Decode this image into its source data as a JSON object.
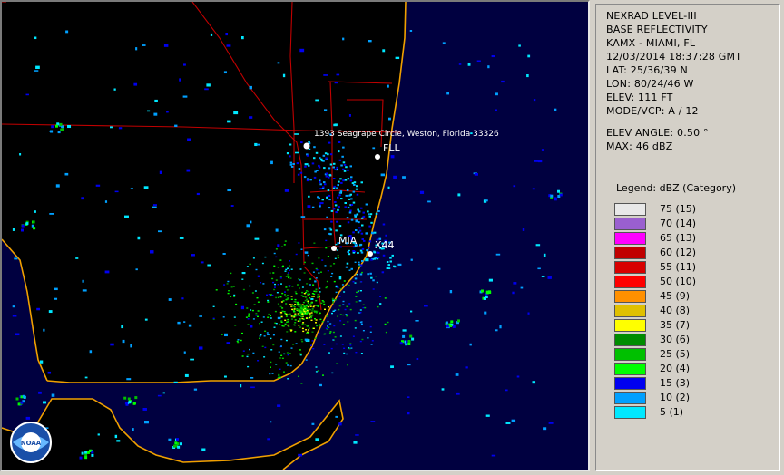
{
  "product": {
    "line1": "NEXRAD LEVEL-III",
    "line2": "BASE REFLECTIVITY",
    "station": "KAMX - MIAMI, FL",
    "datetime": "12/03/2014 18:37:28 GMT",
    "lat": "LAT: 25/36/39 N",
    "lon": "LON: 80/24/46 W",
    "elev": "ELEV: 111 FT",
    "mode": "MODE/VCP: A / 12",
    "elev_angle": "ELEV ANGLE: 0.50 °",
    "max": "MAX: 46 dBZ"
  },
  "legend": {
    "title": "Legend: dBZ (Category)",
    "items": [
      {
        "label": "75  (15)",
        "color": "#e8e8e8"
      },
      {
        "label": "70  (14)",
        "color": "#9a5fcf"
      },
      {
        "label": "65  (13)",
        "color": "#ff00ff"
      },
      {
        "label": "60  (12)",
        "color": "#c00000"
      },
      {
        "label": "55  (11)",
        "color": "#d80000"
      },
      {
        "label": "50  (10)",
        "color": "#ff0000"
      },
      {
        "label": "45  (9)",
        "color": "#ff9000"
      },
      {
        "label": "40  (8)",
        "color": "#e0c000"
      },
      {
        "label": "35  (7)",
        "color": "#ffff00"
      },
      {
        "label": "30  (6)",
        "color": "#008c00"
      },
      {
        "label": "25  (5)",
        "color": "#00c000"
      },
      {
        "label": "20  (4)",
        "color": "#00ff00"
      },
      {
        "label": "15  (3)",
        "color": "#0000f0"
      },
      {
        "label": "10  (2)",
        "color": "#00a0ff"
      },
      {
        "label": "5  (1)",
        "color": "#00e8ff"
      }
    ]
  },
  "map": {
    "address_label": "1393 Seagrape Circle, Weston, Florida 33326",
    "fll_label": "FLL",
    "mia_label": "MIA",
    "x44_label": "X44",
    "logo_text": "NOAA",
    "colors": {
      "background": "#000040",
      "land": "#000000",
      "coast": "#f0a000",
      "roads": "#c00000"
    }
  }
}
